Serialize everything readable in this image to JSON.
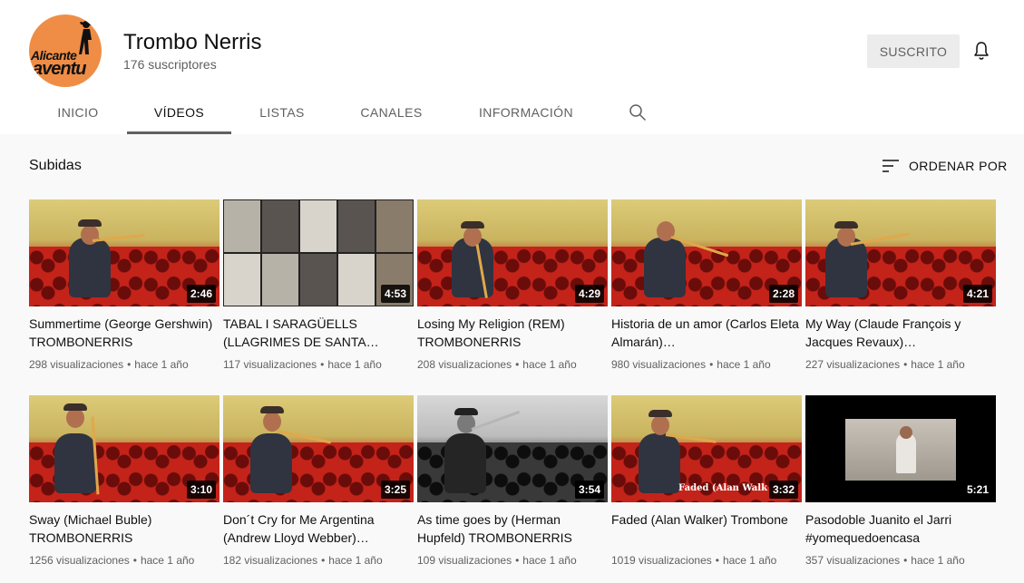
{
  "channel": {
    "name": "Trombo Nerris",
    "subscribers": "176 suscriptores",
    "avatar_text_top": "Alicante",
    "avatar_text_bottom": "aventu",
    "avatar_color": "#ef8d46"
  },
  "subscribe_label": "SUSCRITO",
  "tabs": [
    {
      "label": "INICIO",
      "active": false
    },
    {
      "label": "VÍDEOS",
      "active": true
    },
    {
      "label": "LISTAS",
      "active": false
    },
    {
      "label": "CANALES",
      "active": false
    },
    {
      "label": "INFORMACIÓN",
      "active": false
    }
  ],
  "section": {
    "title": "Subidas",
    "sort_label": "ORDENAR POR"
  },
  "videos": [
    {
      "title": "Summertime (George Gershwin) TROMBONERRIS",
      "duration": "2:46",
      "views": "298 visualizaciones",
      "age": "hace 1 año"
    },
    {
      "title": "TABAL I SARAGÜELLS (LLAGRIMES DE SANTA…",
      "duration": "4:53",
      "views": "117 visualizaciones",
      "age": "hace 1 año"
    },
    {
      "title": "Losing My Religion (REM) TROMBONERRIS",
      "duration": "4:29",
      "views": "208 visualizaciones",
      "age": "hace 1 año"
    },
    {
      "title": "Historia de un amor (Carlos Eleta Almarán)…",
      "duration": "2:28",
      "views": "980 visualizaciones",
      "age": "hace 1 año"
    },
    {
      "title": "My Way (Claude François y Jacques Revaux)…",
      "duration": "4:21",
      "views": "227 visualizaciones",
      "age": "hace 1 año"
    },
    {
      "title": "Sway (Michael Buble) TROMBONERRIS",
      "duration": "3:10",
      "views": "1256 visualizaciones",
      "age": "hace 1 año"
    },
    {
      "title": "Don´t Cry for Me Argentina (Andrew Lloyd Webber)…",
      "duration": "3:25",
      "views": "182 visualizaciones",
      "age": "hace 1 año"
    },
    {
      "title": "As time goes by (Herman Hupfeld) TROMBONERRIS",
      "duration": "3:54",
      "views": "109 visualizaciones",
      "age": "hace 1 año"
    },
    {
      "title": "Faded (Alan Walker) Trombone",
      "duration": "3:32",
      "views": "1019 visualizaciones",
      "age": "hace 1 año",
      "watermark": "Faded (Alan Walk"
    },
    {
      "title": "Pasodoble Juanito el Jarri #yomequedoencasa",
      "duration": "5:21",
      "views": "357 visualizaciones",
      "age": "hace 1 año"
    }
  ]
}
